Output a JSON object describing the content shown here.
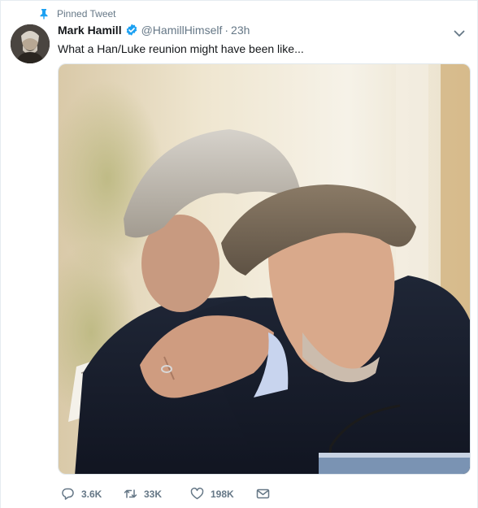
{
  "pinned": {
    "label": "Pinned Tweet",
    "icon": "pin-icon"
  },
  "author": {
    "name": "Mark Hamill",
    "handle": "@HamillHimself",
    "separator": "·",
    "time": "23h",
    "verified_icon": "verified-badge-icon"
  },
  "tweet": {
    "text": "What a Han/Luke reunion might have been like..."
  },
  "actions": {
    "replies": "3.6K",
    "retweets": "33K",
    "likes": "198K"
  },
  "colors": {
    "accent": "#1da1f2",
    "muted": "#657786",
    "text": "#14171a"
  }
}
